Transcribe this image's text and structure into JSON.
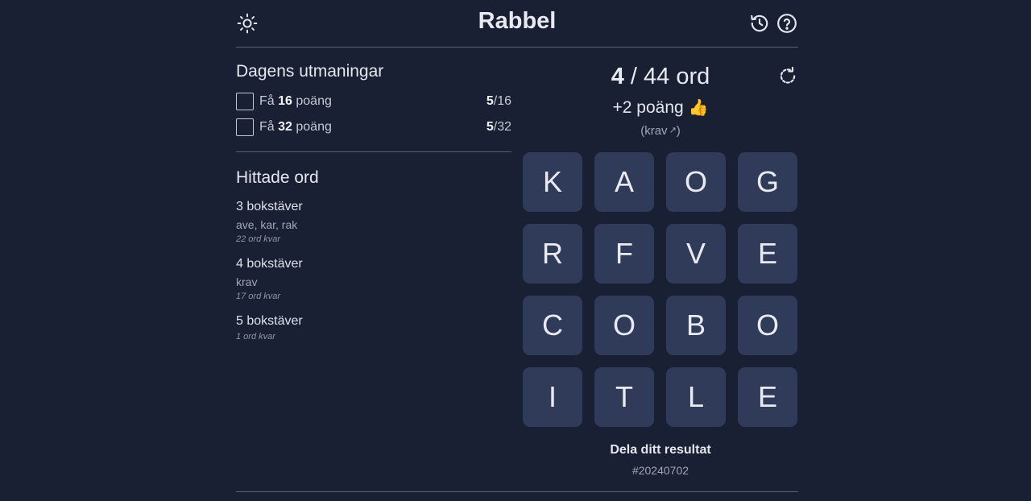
{
  "header": {
    "title": "Rabbel",
    "theme_icon": "sun-icon",
    "history_icon": "history-icon",
    "help_icon": "help-icon"
  },
  "challenges": {
    "title": "Dagens utmaningar",
    "items": [
      {
        "prefix": "Få",
        "target": "16",
        "suffix": "poäng",
        "progress": "5",
        "total": "/16"
      },
      {
        "prefix": "Få",
        "target": "32",
        "suffix": "poäng",
        "progress": "5",
        "total": "/32"
      }
    ]
  },
  "found": {
    "title": "Hittade ord",
    "groups": [
      {
        "title": "3 bokstäver",
        "words": "ave, kar, rak",
        "remaining": "22 ord kvar"
      },
      {
        "title": "4 bokstäver",
        "words": "krav",
        "remaining": "17 ord kvar"
      },
      {
        "title": "5 bokstäver",
        "words": "",
        "remaining": "1 ord kvar"
      }
    ]
  },
  "game": {
    "found_count": "4",
    "total_text": " / 44 ord",
    "points_text": "+2 poäng",
    "points_emoji": "👍",
    "last_word_open": "(krav",
    "last_word_icon": "↗",
    "last_word_close": ")",
    "refresh_icon": "refresh-icon",
    "letters": [
      "K",
      "A",
      "O",
      "G",
      "R",
      "F",
      "V",
      "E",
      "C",
      "O",
      "B",
      "O",
      "I",
      "T",
      "L",
      "E"
    ],
    "share_label": "Dela ditt resultat",
    "game_id": "#20240702"
  },
  "colors": {
    "background": "#1a2033",
    "tile": "#2f3b58",
    "divider": "#5a6173"
  }
}
